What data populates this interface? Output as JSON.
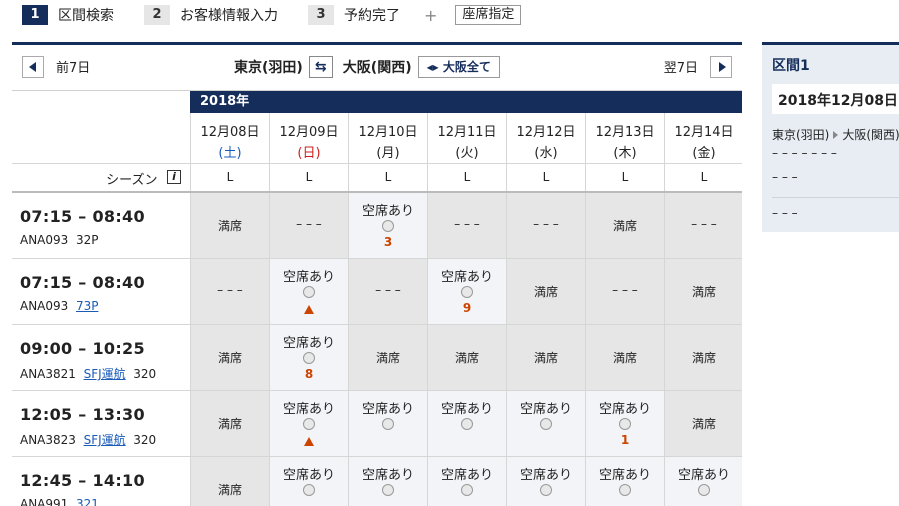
{
  "steps": [
    {
      "num": "1",
      "label": "区間検索"
    },
    {
      "num": "2",
      "label": "お客様情報入力"
    },
    {
      "num": "3",
      "label": "予約完了"
    }
  ],
  "plus_sign": "+",
  "seat_select_label": "座席指定",
  "nav": {
    "prev_label": "前7日",
    "next_label": "翌7日",
    "origin": "東京(羽田)",
    "destination": "大阪(関西)",
    "dest_all_label": "大阪全て"
  },
  "year_label": "2018年",
  "season_label": "シーズン",
  "dates": [
    {
      "date": "12月08日",
      "weekday": "(土)",
      "kind": "sat",
      "season": "L"
    },
    {
      "date": "12月09日",
      "weekday": "(日)",
      "kind": "sun",
      "season": "L"
    },
    {
      "date": "12月10日",
      "weekday": "(月)",
      "kind": "wd",
      "season": "L"
    },
    {
      "date": "12月11日",
      "weekday": "(火)",
      "kind": "wd",
      "season": "L"
    },
    {
      "date": "12月12日",
      "weekday": "(水)",
      "kind": "wd",
      "season": "L"
    },
    {
      "date": "12月13日",
      "weekday": "(木)",
      "kind": "wd",
      "season": "L"
    },
    {
      "date": "12月14日",
      "weekday": "(金)",
      "kind": "wd",
      "season": "L"
    }
  ],
  "flights": [
    {
      "time": "07:15 – 08:40",
      "flight_no": "ANA093",
      "operator": "",
      "aircraft": "32P",
      "aircraft_link": false,
      "cells": [
        {
          "status": "full",
          "text": "満席"
        },
        {
          "status": "none",
          "text": "– – –"
        },
        {
          "status": "avail",
          "text": "空席あり",
          "mark": "3"
        },
        {
          "status": "none",
          "text": "– – –"
        },
        {
          "status": "none",
          "text": "– – –"
        },
        {
          "status": "full",
          "text": "満席"
        },
        {
          "status": "none",
          "text": "– – –"
        }
      ]
    },
    {
      "time": "07:15 – 08:40",
      "flight_no": "ANA093",
      "operator": "",
      "aircraft": "73P",
      "aircraft_link": true,
      "cells": [
        {
          "status": "none",
          "text": "– – –"
        },
        {
          "status": "avail",
          "text": "空席あり",
          "mark": "▲"
        },
        {
          "status": "none",
          "text": "– – –"
        },
        {
          "status": "avail",
          "text": "空席あり",
          "mark": "9"
        },
        {
          "status": "full",
          "text": "満席"
        },
        {
          "status": "none",
          "text": "– – –"
        },
        {
          "status": "full",
          "text": "満席"
        }
      ]
    },
    {
      "time": "09:00 – 10:25",
      "flight_no": "ANA3821",
      "operator": "SFJ運航",
      "aircraft": "320",
      "aircraft_link": false,
      "cells": [
        {
          "status": "full",
          "text": "満席"
        },
        {
          "status": "avail",
          "text": "空席あり",
          "mark": "8"
        },
        {
          "status": "full",
          "text": "満席"
        },
        {
          "status": "full",
          "text": "満席"
        },
        {
          "status": "full",
          "text": "満席"
        },
        {
          "status": "full",
          "text": "満席"
        },
        {
          "status": "full",
          "text": "満席"
        }
      ]
    },
    {
      "time": "12:05 – 13:30",
      "flight_no": "ANA3823",
      "operator": "SFJ運航",
      "aircraft": "320",
      "aircraft_link": false,
      "cells": [
        {
          "status": "full",
          "text": "満席"
        },
        {
          "status": "avail",
          "text": "空席あり",
          "mark": "▲"
        },
        {
          "status": "avail",
          "text": "空席あり",
          "mark": ""
        },
        {
          "status": "avail",
          "text": "空席あり",
          "mark": ""
        },
        {
          "status": "avail",
          "text": "空席あり",
          "mark": ""
        },
        {
          "status": "avail",
          "text": "空席あり",
          "mark": "1"
        },
        {
          "status": "full",
          "text": "満席"
        }
      ]
    },
    {
      "time": "12:45 – 14:10",
      "flight_no": "ANA991",
      "operator": "",
      "aircraft": "321",
      "aircraft_link": true,
      "cells": [
        {
          "status": "full",
          "text": "満席"
        },
        {
          "status": "avail",
          "text": "空席あり",
          "mark": ""
        },
        {
          "status": "avail",
          "text": "空席あり",
          "mark": ""
        },
        {
          "status": "avail",
          "text": "空席あり",
          "mark": ""
        },
        {
          "status": "avail",
          "text": "空席あり",
          "mark": ""
        },
        {
          "status": "avail",
          "text": "空席あり",
          "mark": ""
        },
        {
          "status": "avail",
          "text": "空席あり",
          "mark": ""
        }
      ]
    }
  ],
  "side": {
    "title": "区間1",
    "date": "2018年12月08日",
    "origin": "東京(羽田)",
    "destination": "大阪(関西)",
    "time": "– – –  –  – – –",
    "flight": "– – –",
    "extra": "– – –"
  },
  "colors": {
    "brand": "#142D5A",
    "full_bg": "#e6e6e6",
    "open_bg": "#f2f4f8",
    "mark": "#cc4400"
  }
}
